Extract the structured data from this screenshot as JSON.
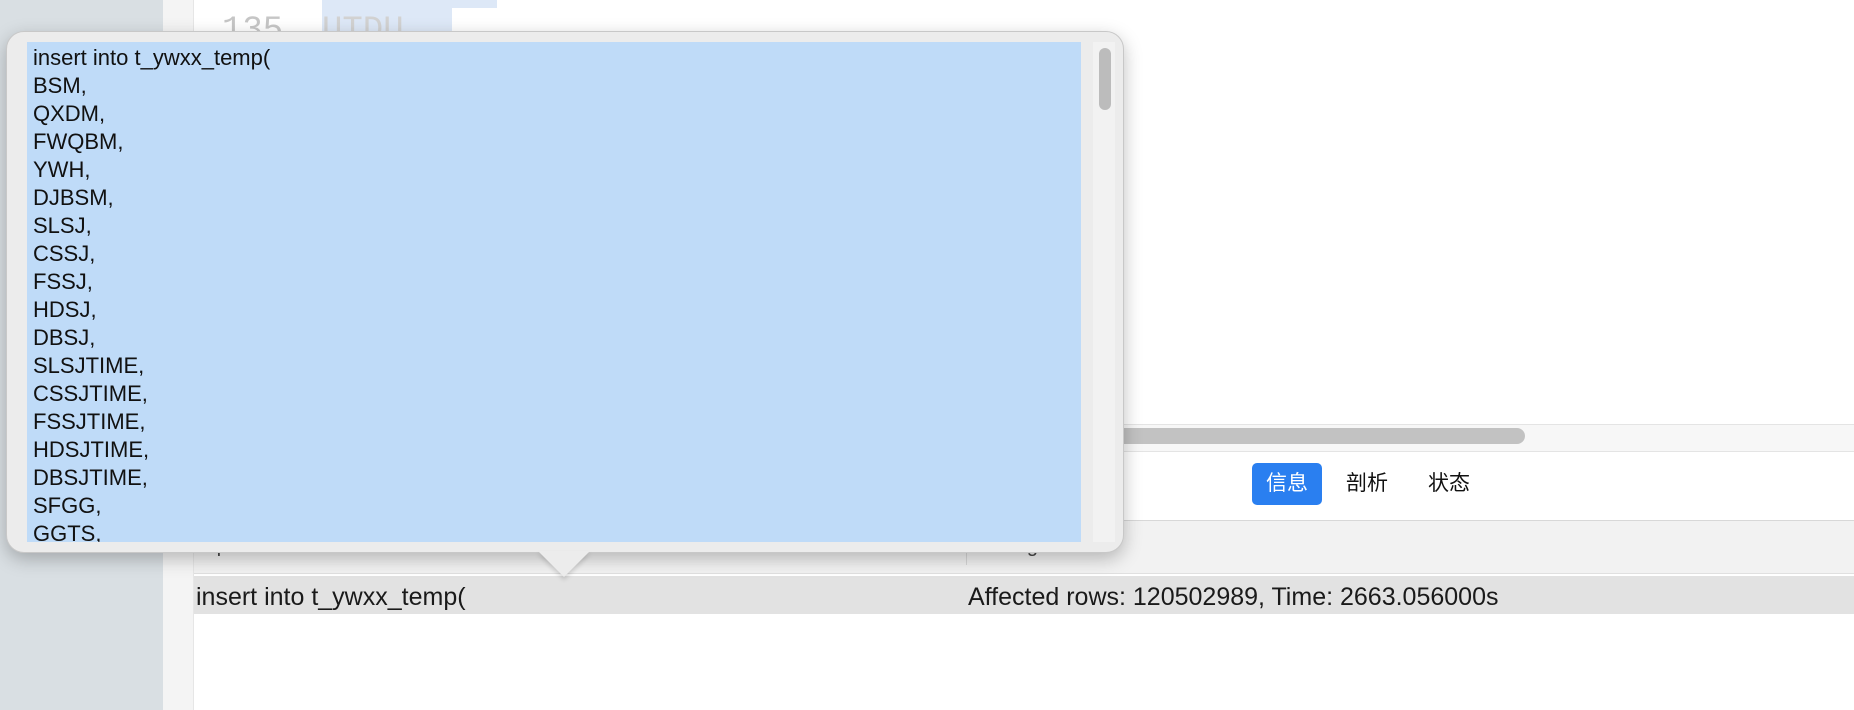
{
  "editor": {
    "line_number": "135",
    "code_line": "UTDU"
  },
  "tabs": [
    {
      "label": "信息",
      "active": true
    },
    {
      "label": "剖析",
      "active": false
    },
    {
      "label": "状态",
      "active": false
    }
  ],
  "results": {
    "columns": [
      "sql",
      "message"
    ],
    "row": {
      "sql": "insert into t_ywxx_temp(",
      "message": "Affected rows: 120502989, Time: 2663.056000s"
    }
  },
  "popover": {
    "lines": [
      "insert into t_ywxx_temp(",
      "BSM,",
      "QXDM,",
      "FWQBM,",
      "YWH,",
      "DJBSM,",
      "SLSJ,",
      "CSSJ,",
      "FSSJ,",
      "HDSJ,",
      "DBSJ,",
      "SLSJTIME,",
      "CSSJTIME,",
      "FSSJTIME,",
      "HDSJTIME,",
      "DBSJTIME,",
      "SFGG,",
      "GGTS,"
    ]
  },
  "colors": {
    "accent": "#2a7ff0",
    "selection": "#bfdbf8",
    "sidebar": "#d9dfe3"
  }
}
